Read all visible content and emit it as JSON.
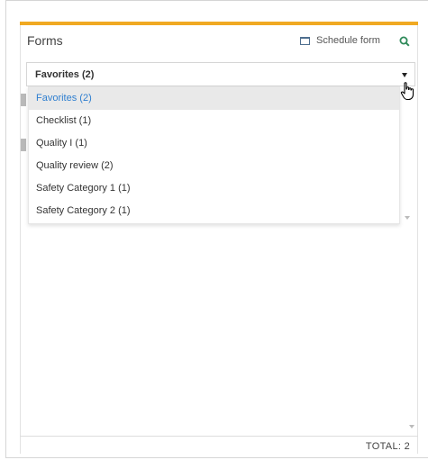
{
  "header": {
    "title": "Forms",
    "schedule_label": "Schedule form",
    "schedule_icon": "calendar-icon",
    "search_icon": "search-icon"
  },
  "colors": {
    "accent": "#f0a922",
    "selected_text": "#2f7fd0",
    "selected_bg": "#e9e9e9"
  },
  "select": {
    "value": "Favorites (2)",
    "options": [
      {
        "label": "Favorites (2)",
        "selected": true
      },
      {
        "label": "Checklist (1)",
        "selected": false
      },
      {
        "label": "Quality I (1)",
        "selected": false
      },
      {
        "label": "Quality review (2)",
        "selected": false
      },
      {
        "label": "Safety Category 1 (1)",
        "selected": false
      },
      {
        "label": "Safety Category 2 (1)",
        "selected": false
      }
    ]
  },
  "footer": {
    "total_label": "TOTAL:",
    "total_value": "2"
  }
}
